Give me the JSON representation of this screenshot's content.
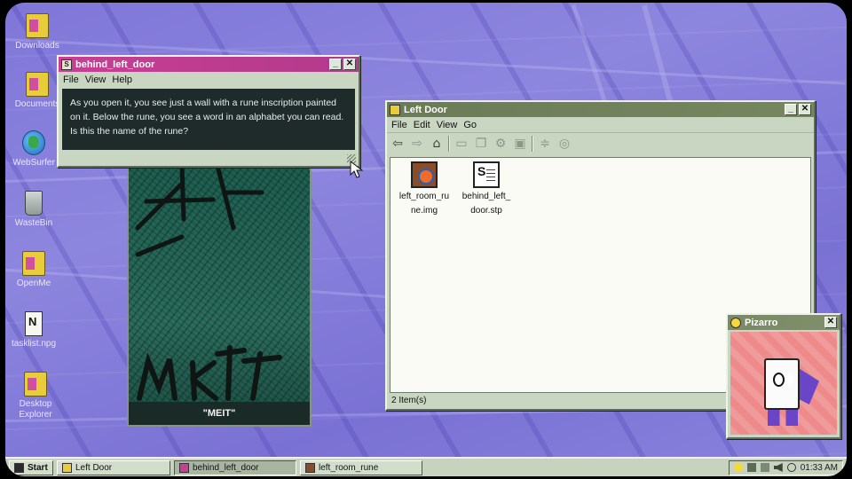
{
  "desktop": {
    "icons": [
      {
        "label": "Downloads",
        "icon": "folder-icon"
      },
      {
        "label": "Documents",
        "icon": "folder-icon"
      },
      {
        "label": "WebSurfer",
        "icon": "globe-icon"
      },
      {
        "label": "WasteBin",
        "icon": "trash-icon"
      },
      {
        "label": "OpenMe",
        "icon": "folder-icon"
      },
      {
        "label": "tasklist.npg",
        "icon": "document-icon"
      },
      {
        "label": "Desktop Explorer",
        "icon": "folder-icon"
      }
    ]
  },
  "dialog": {
    "title": "behind_left_door",
    "menu": [
      "File",
      "View",
      "Help"
    ],
    "text": "As you open it, you see just a wall with a rune inscription painted on it. Below the rune, you see a word in an alphabet you can read. Is this the name of the rune?"
  },
  "rune_image": {
    "caption": "\"MEIT\""
  },
  "explorer": {
    "title": "Left Door",
    "menu": [
      "File",
      "Edit",
      "View",
      "Go"
    ],
    "files": [
      {
        "name": "left_room_ru ne.img",
        "icon": "image-file-icon"
      },
      {
        "name": "behind_left_ door.stp",
        "icon": "stp-file-icon"
      }
    ],
    "status": "2 Item(s)"
  },
  "assistant": {
    "title": "Pizarro"
  },
  "taskbar": {
    "start_label": "Start",
    "items": [
      "Left Door",
      "behind_left_door",
      "left_room_rune"
    ],
    "active_index": 1,
    "clock": "01:33 AM"
  },
  "colors": {
    "desktop_bg": "#8079d8",
    "dialog_title": "#c83f94",
    "explorer_title": "#6a7b57",
    "window_chrome": "#c9d6c1"
  }
}
